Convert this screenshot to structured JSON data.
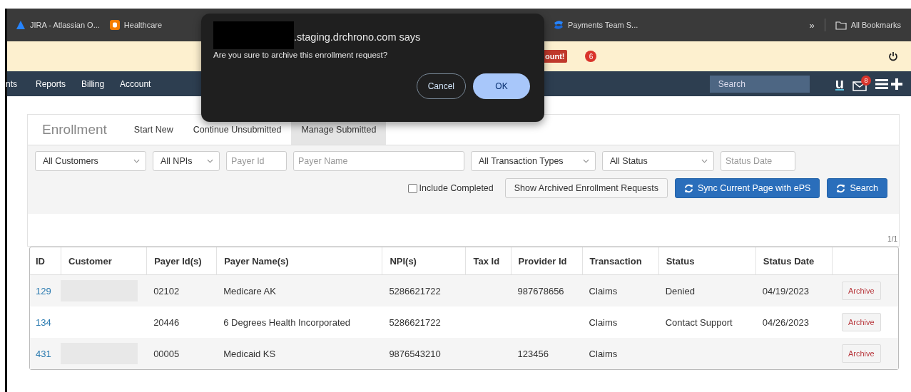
{
  "bookmarks": {
    "items": [
      {
        "label": "JIRA - Atlassian O...",
        "kind": "atlassian"
      },
      {
        "label": "Healthcare",
        "kind": "blogger"
      },
      {
        "label": "Payments Team S...",
        "kind": "confluence"
      }
    ],
    "overflow": "»",
    "all_bookmarks": "All Bookmarks"
  },
  "banner": {
    "badges": [
      {
        "text": "ount!",
        "kind": "label"
      },
      {
        "text": "6",
        "kind": "count"
      }
    ]
  },
  "nav": {
    "items": [
      "nts",
      "Reports",
      "Billing",
      "Account"
    ],
    "search_placeholder": "Search",
    "logo": "u",
    "mail_count": "8"
  },
  "enrollment": {
    "title": "Enrollment",
    "tabs": [
      {
        "label": "Start New",
        "selected": false
      },
      {
        "label": "Continue Unsubmitted",
        "selected": false
      },
      {
        "label": "Manage Submitted",
        "selected": true
      }
    ],
    "filters": [
      {
        "kind": "select",
        "value": "All Customers"
      },
      {
        "kind": "select",
        "value": "All NPIs"
      },
      {
        "kind": "input",
        "placeholder": "Payer Id"
      },
      {
        "kind": "input",
        "placeholder": "Payer Name"
      },
      {
        "kind": "select",
        "value": "All Transaction Types"
      },
      {
        "kind": "select",
        "value": "All Status"
      },
      {
        "kind": "input",
        "placeholder": "Status Date"
      }
    ],
    "include_completed": {
      "label": "Include Completed",
      "checked": false
    },
    "buttons": [
      {
        "label": "Show Archived Enrollment Requests",
        "kind": "default"
      },
      {
        "label": "Sync Current Page with ePS",
        "kind": "primary"
      },
      {
        "label": "Search",
        "kind": "primary"
      }
    ],
    "pagination": "1/1"
  },
  "table": {
    "columns": [
      "ID",
      "Customer",
      "Payer Id(s)",
      "Payer Name(s)",
      "NPI(s)",
      "Tax Id",
      "Provider Id",
      "Transaction",
      "Status",
      "Status Date"
    ],
    "rows": [
      {
        "id": "129",
        "customer_redacted": true,
        "payer_id": "02102",
        "payer_name": "Medicare AK",
        "npi": "5286621722",
        "tax_id": "",
        "provider_id": "987678656",
        "transaction": "Claims",
        "status": "Denied",
        "status_date": "04/19/2023",
        "action": "Archive"
      },
      {
        "id": "134",
        "customer_redacted": false,
        "payer_id": "20446",
        "payer_name": "6 Degrees Health Incorporated",
        "npi": "5286621722",
        "tax_id": "",
        "provider_id": "",
        "transaction": "Claims",
        "status": "Contact Support",
        "status_date": "04/26/2023",
        "action": "Archive"
      },
      {
        "id": "431",
        "customer_redacted": true,
        "payer_id": "00005",
        "payer_name": "Medicaid KS",
        "npi": "9876543210",
        "tax_id": "",
        "provider_id": "123456",
        "transaction": "Claims",
        "status": "",
        "status_date": "",
        "action": "Archive"
      }
    ]
  },
  "dialog": {
    "title": ".staging.drchrono.com says",
    "message": "Are you sure to archive this enrollment request?",
    "buttons": [
      {
        "label": "Cancel",
        "kind": "secondary"
      },
      {
        "label": "OK",
        "kind": "primary"
      }
    ]
  }
}
